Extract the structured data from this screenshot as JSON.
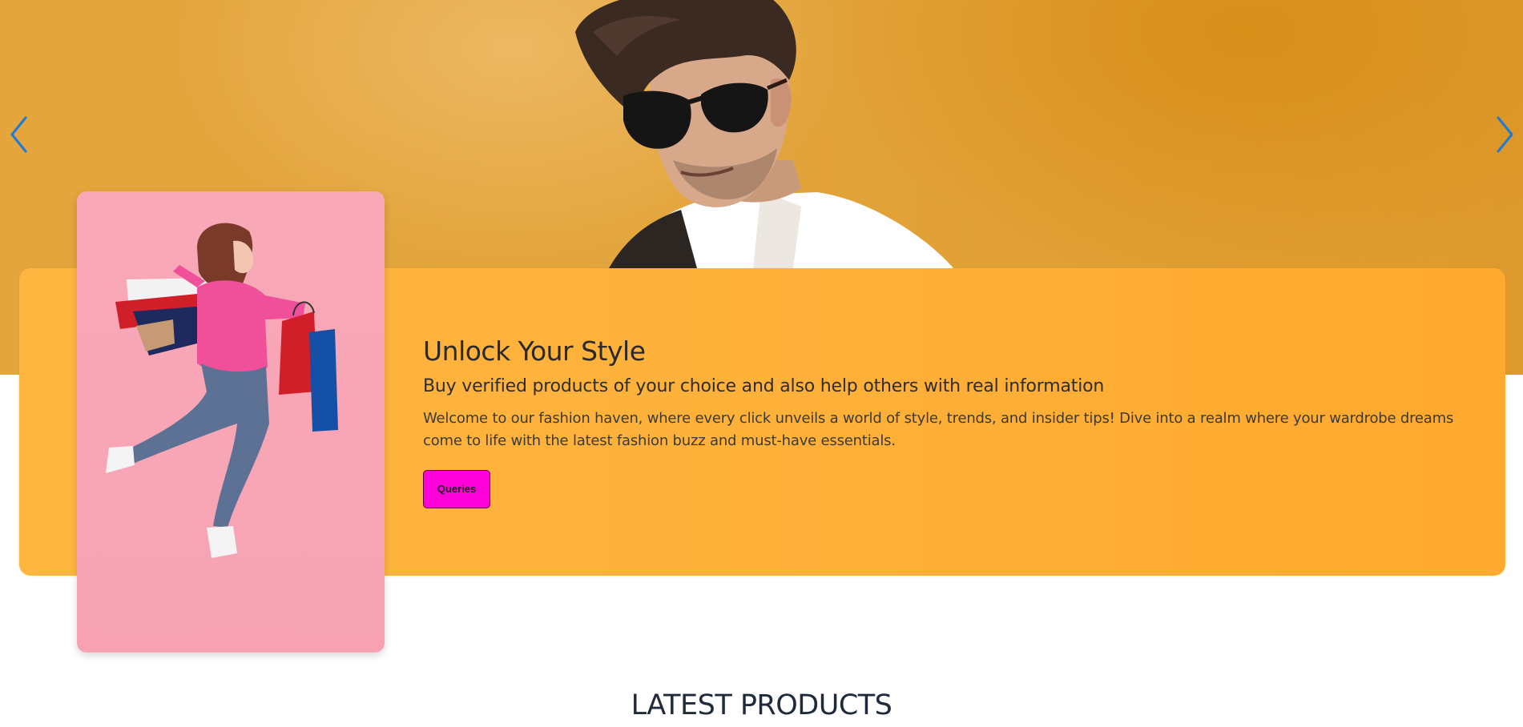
{
  "hero": {
    "prev_icon": "chevron-left-icon",
    "next_icon": "chevron-right-icon",
    "background_color": "#e3a53d",
    "arrow_color": "#1e7bd6"
  },
  "promo": {
    "title": "Unlock Your Style",
    "subtitle": "Buy verified products of your choice and also help others with real information",
    "description": "Welcome to our fashion haven, where every click unveils a world of style, trends, and insider tips! Dive into a realm where your wardrobe dreams come to life with the latest fashion buzz and must-have essentials.",
    "button_label": "Queries",
    "card_color": "#ffb13a",
    "photo_background": "#f7a5b5",
    "button_color": "#ff00d8"
  },
  "latest": {
    "title": "LATEST PRODUCTS"
  }
}
